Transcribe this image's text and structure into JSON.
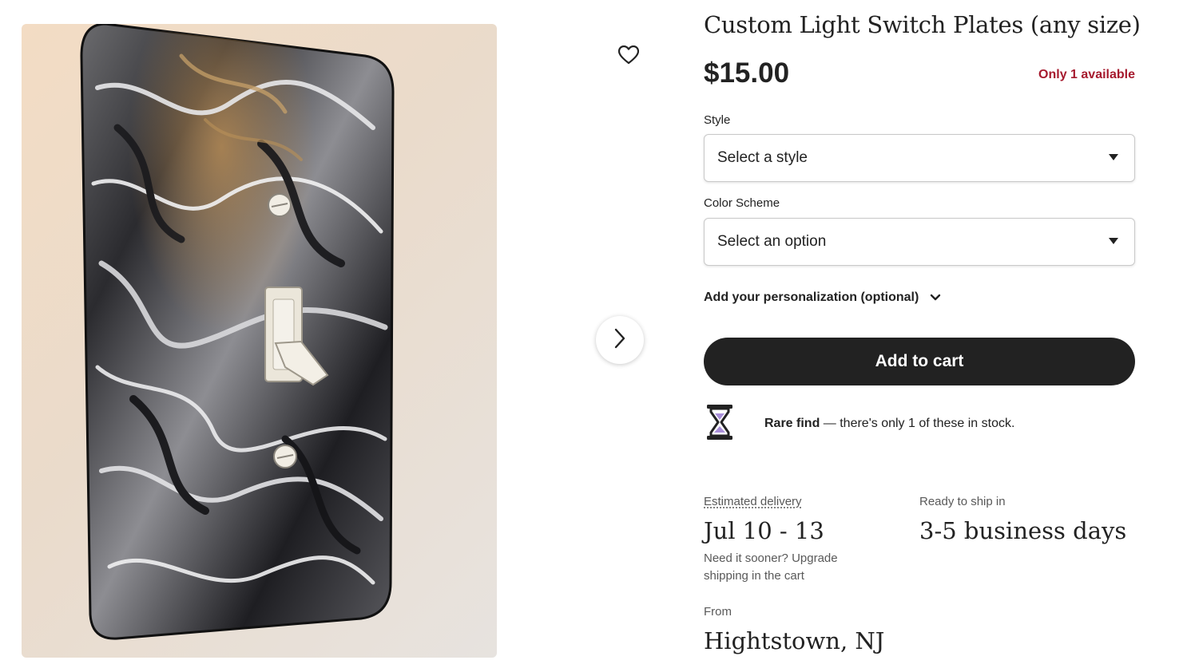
{
  "product": {
    "title": "Custom Light Switch Plates (any size)",
    "price": "$15.00",
    "stock_badge": "Only 1 available",
    "image_alt_icon": "product-photo"
  },
  "options": {
    "style_label": "Style",
    "style_value": "Select a style",
    "color_label": "Color Scheme",
    "color_value": "Select an option"
  },
  "personalization": {
    "label": "Add your personalization (optional)"
  },
  "cart": {
    "button_label": "Add to cart"
  },
  "rare_find": {
    "bold": "Rare find",
    "rest": " — there's only 1 of these in stock."
  },
  "delivery": {
    "estimated_label": "Estimated delivery",
    "estimated_dates": "Jul 10 - 13",
    "sooner_note": "Need it sooner? Upgrade shipping in the cart",
    "ready_label": "Ready to ship in",
    "ready_value": "3-5 business days",
    "from_label": "From",
    "from_value": "Hightstown, NJ"
  },
  "colors": {
    "text": "#222222",
    "muted": "#595959",
    "stock_red": "#a61a2e",
    "cart_bg": "#222222",
    "hourglass_sand": "#a98fd8"
  },
  "icons": {
    "favorite": "heart-outline-icon",
    "next": "chevron-right-icon",
    "dropdown": "caret-down-icon",
    "expand": "chevron-down-icon",
    "rare": "hourglass-icon"
  }
}
